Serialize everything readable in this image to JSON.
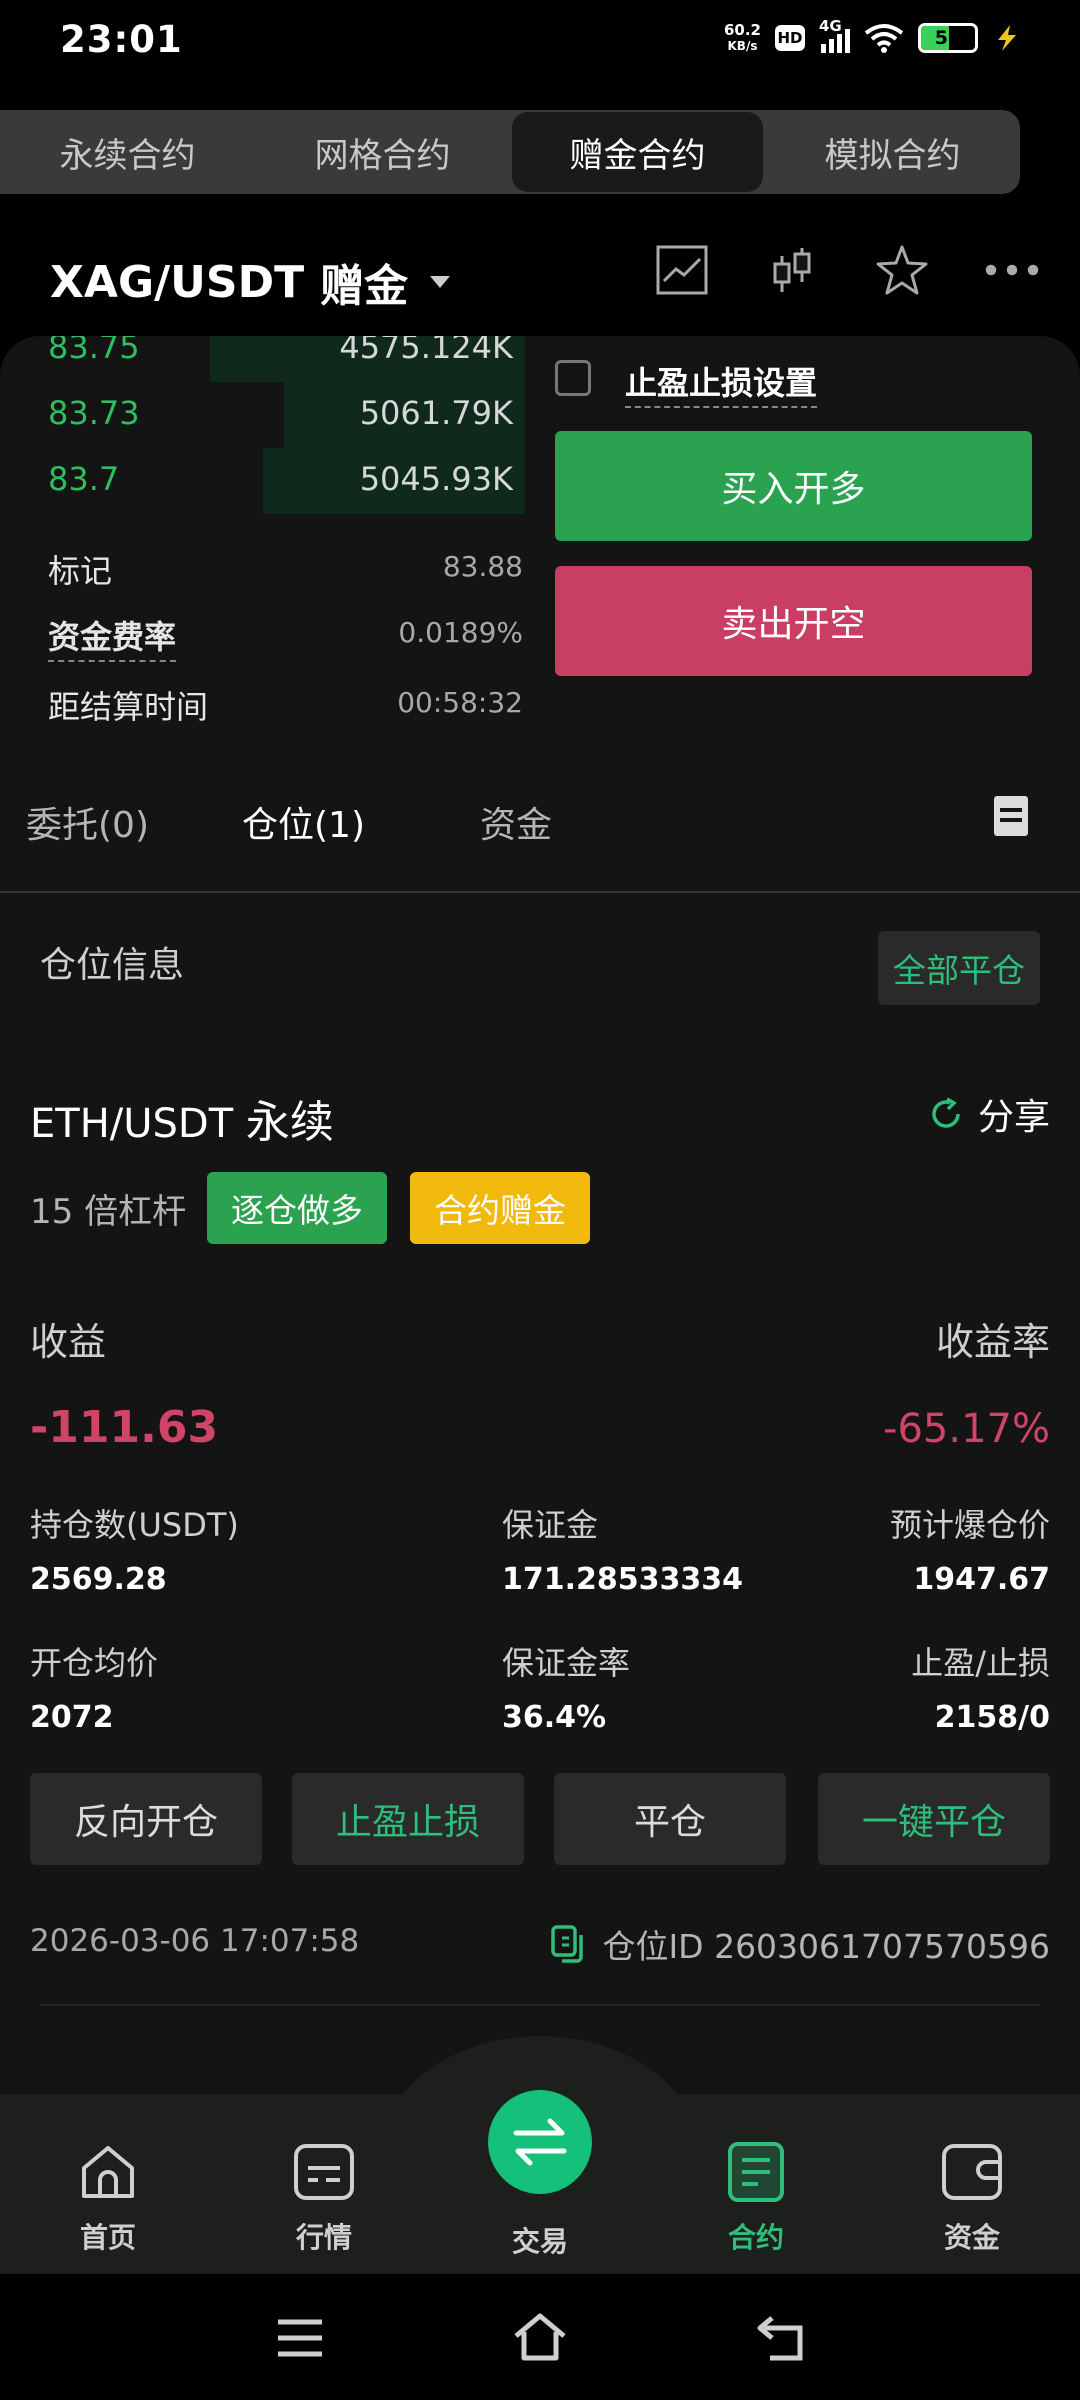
{
  "status_bar": {
    "time": "23:01",
    "net_speed_value": "60.2",
    "net_speed_unit": "KB/s",
    "hd": "HD",
    "network": "4G",
    "battery": "51",
    "battery_level": 0.51,
    "battery_color": "#3ccf5a"
  },
  "top_tabs": [
    "永续合约",
    "网格合约",
    "赠金合约",
    "模拟合约"
  ],
  "active_tab": "赠金合约",
  "pair": {
    "symbol": "XAG/USDT",
    "type": "赠金"
  },
  "header_icons": [
    "chart-icon",
    "candlestick-icon",
    "star-icon",
    "more-icon"
  ],
  "order_book": [
    {
      "price": "83.75",
      "qty": "4575.124K",
      "depth": 0.6
    },
    {
      "price": "83.73",
      "qty": "5061.79K",
      "depth": 0.46
    },
    {
      "price": "83.7",
      "qty": "5045.93K",
      "depth": 0.5
    }
  ],
  "info": {
    "mark_label": "标记",
    "mark_value": "83.88",
    "funding_label": "资金费率",
    "funding_value": "0.0189%",
    "settle_label": "距结算时间",
    "settle_value": "00:58:32"
  },
  "trade": {
    "tpsl_label": "止盈止损设置",
    "buy_label": "买入开多",
    "sell_label": "卖出开空"
  },
  "sub_tabs": {
    "orders": "委托(0)",
    "positions": "仓位(1)",
    "funds": "资金"
  },
  "position": {
    "section_title": "仓位信息",
    "close_all": "全部平仓",
    "symbol": "ETH/USDT",
    "kind": "永续",
    "share": "分享",
    "leverage": "15 倍杠杆",
    "mode_badge": "逐仓做多",
    "bonus_badge": "合约赠金",
    "pnl_label": "收益",
    "pnl_rate_label": "收益率",
    "pnl_value": "-111.63",
    "pnl_rate_value": "-65.17%",
    "size_label": "持仓数(USDT)",
    "size_value": "2569.28",
    "margin_label": "保证金",
    "margin_value": "171.28533334",
    "liq_label": "预计爆仓价",
    "liq_value": "1947.67",
    "entry_label": "开仓均价",
    "entry_value": "2072",
    "margin_rate_label": "保证金率",
    "margin_rate_value": "36.4%",
    "tpsl_label": "止盈/止损",
    "tpsl_value": "2158/0",
    "btn_reverse": "反向开仓",
    "btn_tpsl": "止盈止损",
    "btn_close": "平仓",
    "btn_quick_close": "一键平仓",
    "time": "2026-03-06 17:07:58",
    "id_label": "仓位ID 2603061707570596"
  },
  "bottom_nav": {
    "home": "首页",
    "market": "行情",
    "trade": "交易",
    "contract": "合约",
    "assets": "资金"
  },
  "colors": {
    "green": "#2aa24f",
    "red": "#c93f63",
    "accent": "#2ebd7a",
    "yellow": "#f0b90b"
  }
}
